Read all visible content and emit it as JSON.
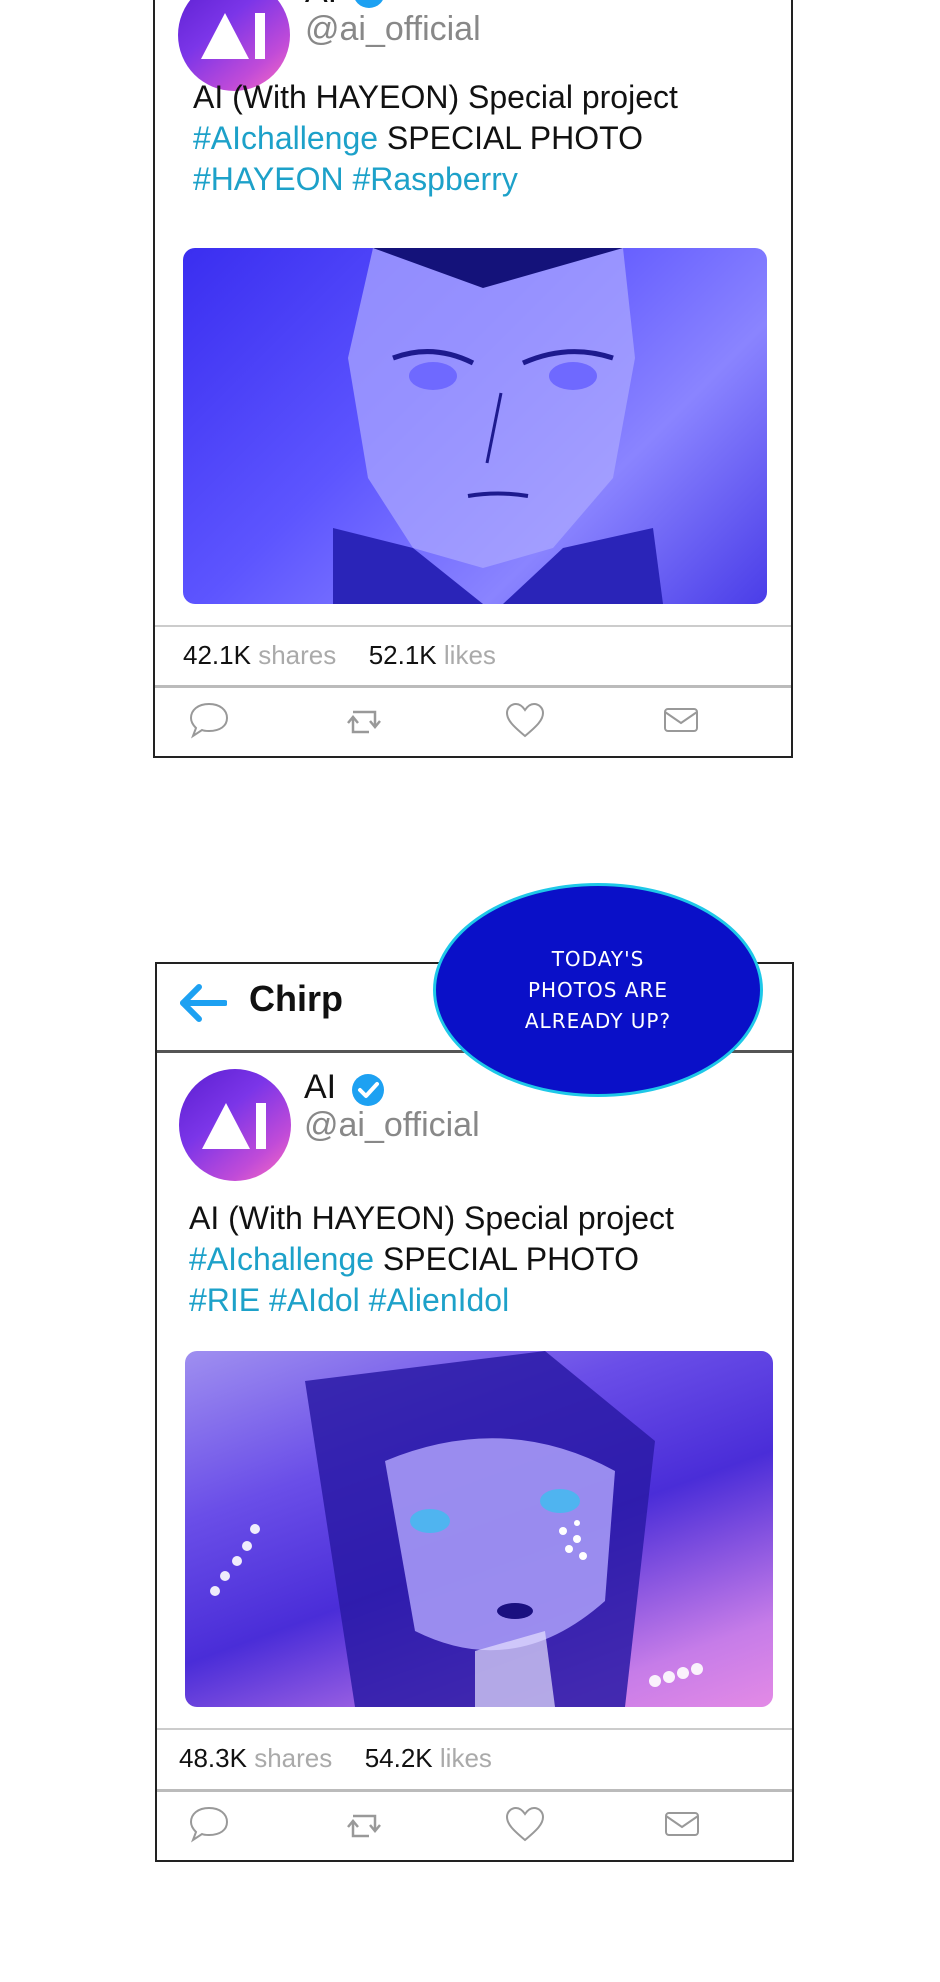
{
  "post1": {
    "account_name": "AI",
    "handle": "@ai_official",
    "text_line1": "AI (With HAYEON) Special project",
    "tag_challenge": "#AIchallenge",
    "text_special": " SPECIAL PHOTO",
    "tags_line3": "#HAYEON #Raspberry",
    "shares_count": "42.1K",
    "shares_label": "shares",
    "likes_count": "52.1K",
    "likes_label": "likes"
  },
  "speech_bubble": {
    "text": "TODAY'S\nPHOTOS ARE\nALREADY UP?"
  },
  "post2": {
    "app_title": "Chirp",
    "account_name": "AI",
    "handle": "@ai_official",
    "text_line1": "AI (With HAYEON) Special project",
    "tag_challenge": "#AIchallenge",
    "text_special": " SPECIAL PHOTO",
    "tags_line3": "#RIE #AIdol #AlienIdol",
    "shares_count": "48.3K",
    "shares_label": "shares",
    "likes_count": "54.2K",
    "likes_label": "likes"
  },
  "icons": [
    "verified-check-icon",
    "comment-icon",
    "retweet-icon",
    "heart-icon",
    "mail-icon",
    "back-arrow-icon"
  ],
  "colors": {
    "hashtag": "#1da1c9",
    "bubble_fill": "#0a10c8",
    "bubble_border": "#1ec8e8",
    "verified": "#1da1f2"
  }
}
